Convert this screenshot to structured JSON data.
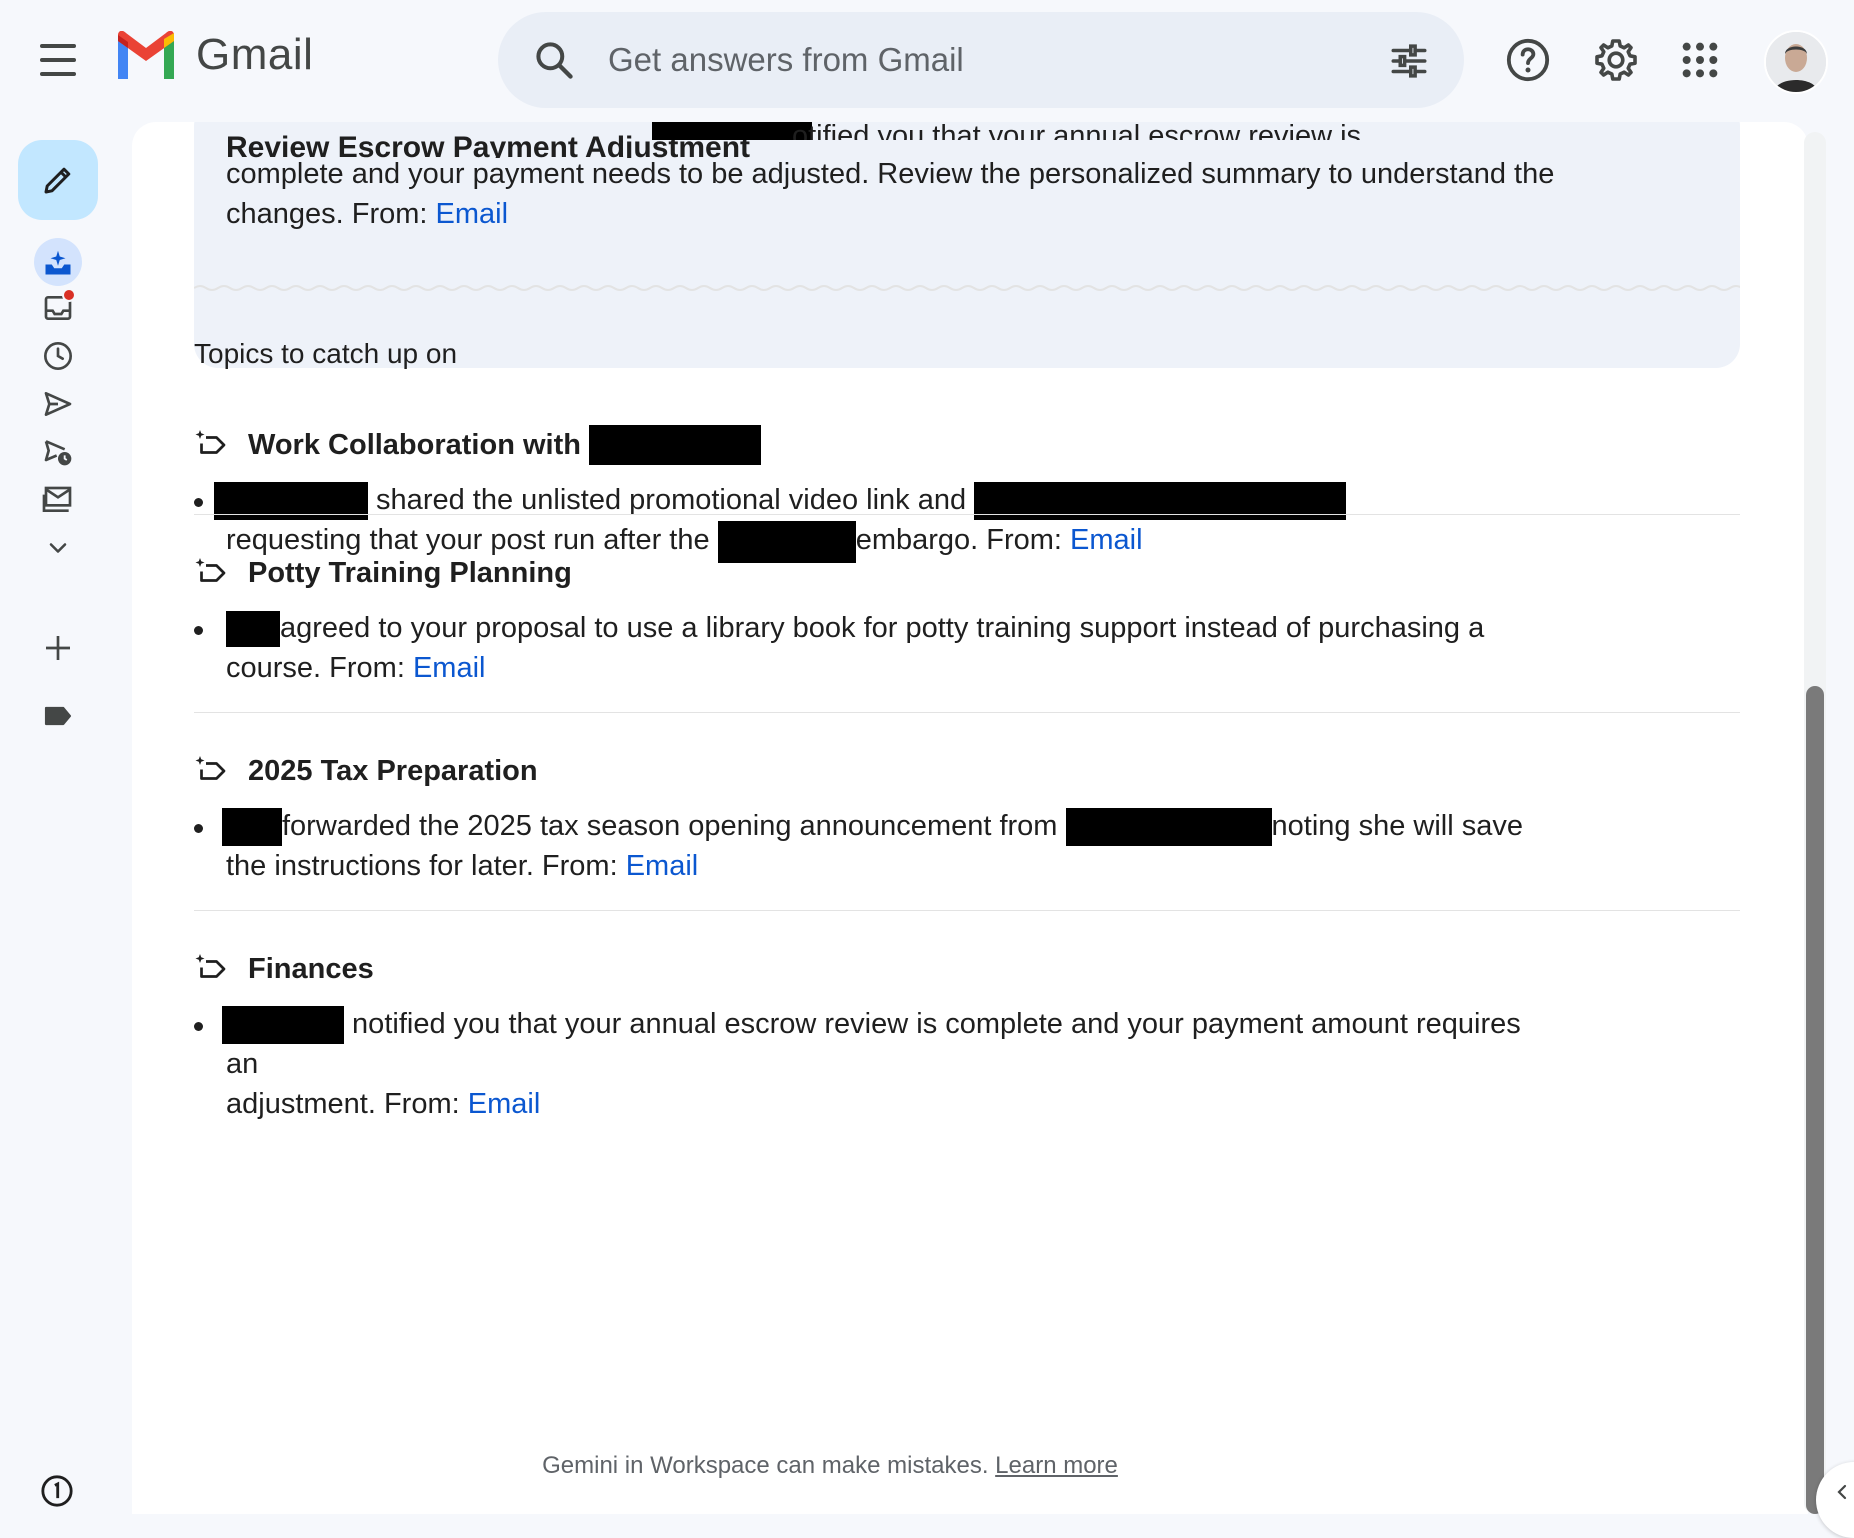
{
  "app": {
    "logo_text": "Gmail",
    "search_placeholder": "Get answers from Gmail"
  },
  "rail": {
    "items": [
      "compose",
      "summary",
      "inbox",
      "snoozed",
      "sent",
      "scheduled",
      "all-mail",
      "more",
      "add-label",
      "label"
    ]
  },
  "summary": {
    "heading_visible": "Review Escrow Payment Adjustment",
    "text_part1": "otified you that your annual escrow review is",
    "text_part2": "complete and your payment needs to be adjusted. Review the personalized summary to understand the",
    "text_part3": "changes. From: ",
    "link": "Email"
  },
  "section_title": "Topics to catch up on",
  "topics": [
    {
      "title": "Work Collaboration with",
      "part1": " shared the unlisted promotional video link and ",
      "part2": "requesting that your post run after the ",
      "part3": "embargo. From: ",
      "link": "Email"
    },
    {
      "title": "Potty Training Planning",
      "part1": "agreed to your proposal to use a library book for potty training support instead of purchasing a",
      "part2": "course. From: ",
      "link": "Email"
    },
    {
      "title": "2025 Tax Preparation",
      "part1": "forwarded the 2025 tax season opening announcement from ",
      "part2": "noting she will save",
      "part3": "the instructions for later. From: ",
      "link": "Email"
    },
    {
      "title": "Finances",
      "part1": " notified you that your annual escrow review is complete and your payment amount requires an",
      "part2": "adjustment. From: ",
      "link": "Email"
    }
  ],
  "footer": {
    "disclaimer": "Gemini in Workspace can make mistakes. ",
    "learn_more": "Learn more"
  },
  "colors": {
    "link": "#0b57d0",
    "compose_bg": "#c2e7ff",
    "search_bg": "#e9eef6",
    "page_bg": "#f6f8fc",
    "badge": "#d93025"
  }
}
